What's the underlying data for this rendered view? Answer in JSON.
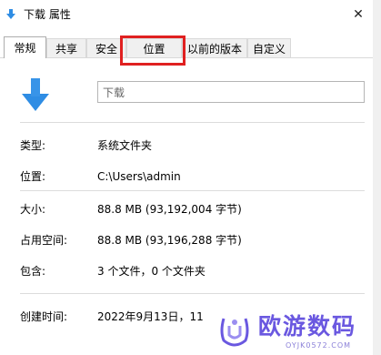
{
  "window": {
    "title": "下载 属性",
    "close_glyph": "✕"
  },
  "tabs": [
    {
      "label": "常规",
      "active": true
    },
    {
      "label": "共享",
      "active": false
    },
    {
      "label": "安全",
      "active": false
    },
    {
      "label": "位置",
      "active": false,
      "highlighted": true
    },
    {
      "label": "以前的版本",
      "active": false
    },
    {
      "label": "自定义",
      "active": false
    }
  ],
  "general": {
    "icon": "download-arrow-icon",
    "name_value": "下载",
    "rows": [
      {
        "label": "类型:",
        "value": "系统文件夹"
      },
      {
        "label": "位置:",
        "value": "C:\\Users\\admin"
      },
      {
        "label": "大小:",
        "value": "88.8 MB (93,192,004 字节)"
      },
      {
        "label": "占用空间:",
        "value": "88.8 MB (93,196,288 字节)"
      },
      {
        "label": "包含:",
        "value": "3 个文件，0 个文件夹"
      },
      {
        "label": "创建时间:",
        "value": "2022年9月13日，11"
      }
    ]
  },
  "watermark": {
    "text": "欧游数码",
    "sub": "OYJK0572.COM"
  },
  "colors": {
    "highlight": "#e02020",
    "arrow": "#2f8de4",
    "watermark": "#6a58e0"
  }
}
